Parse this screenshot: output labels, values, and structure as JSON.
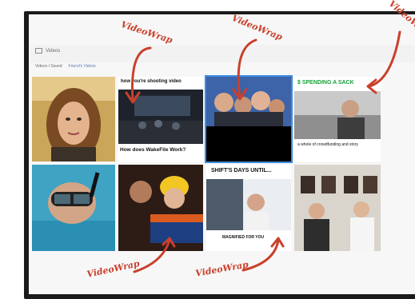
{
  "window": {
    "title": "Videos"
  },
  "filters": [
    "Videos I Saved",
    "Friend's Videos"
  ],
  "tiles": [
    {
      "caption": ""
    },
    {
      "caption_top": "how you're shooting video",
      "caption_bottom": "How does WakeFile Work?",
      "duration": ""
    },
    {
      "caption": ""
    },
    {
      "caption_top": "$ SPENDING A SACK",
      "caption_bottom": "a whole of crowdfunding and story",
      "duration": ""
    },
    {
      "caption": ""
    },
    {
      "caption": ""
    },
    {
      "caption_top": "SHIFT'S DAYS UNTIL...",
      "caption_bottom": "MAGNIFIED FOR YOU",
      "duration": ""
    },
    {
      "caption": ""
    }
  ],
  "annotations": [
    "VideoWrap",
    "VideoWrap",
    "VideoWrap",
    "VideoWrap",
    "VideoWrap"
  ],
  "colors": {
    "annotation": "#c9402b",
    "selection": "#3c8de0"
  }
}
